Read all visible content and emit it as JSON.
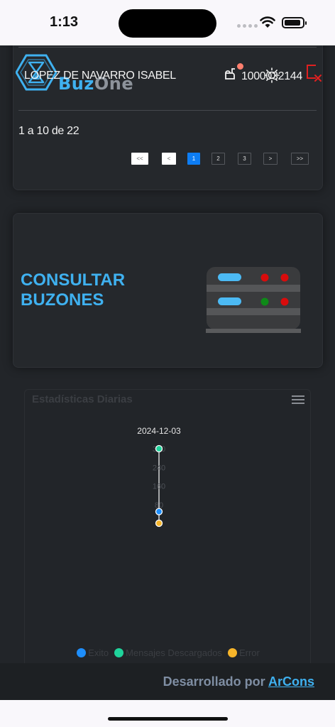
{
  "status": {
    "time": "1:13"
  },
  "header": {
    "logo_prefix": "Buz",
    "logo_suffix": "One",
    "user_name": "LOPEZ DE NAVARRO ISABEL",
    "user_id": "1000032144"
  },
  "pagination": {
    "info": "1 a 10 de 22",
    "first": "<<",
    "prev": "<",
    "pages": [
      "1",
      "2",
      "3"
    ],
    "next": ">",
    "last": ">>",
    "current_page": "1"
  },
  "consult": {
    "title": "CONSULTAR BUZONES"
  },
  "chart_data": {
    "type": "line",
    "title": "Estadísticas Diarias",
    "x": [
      "2024-12-03"
    ],
    "y_ticks": [
      0,
      80,
      160,
      240,
      320
    ],
    "ylim": [
      0,
      320
    ],
    "series": [
      {
        "name": "Exito",
        "color": "#1e8efb",
        "values": [
          50
        ]
      },
      {
        "name": "Mensajes Descargados",
        "color": "#1fd39b",
        "values": [
          320
        ]
      },
      {
        "name": "Error",
        "color": "#f7b52a",
        "values": [
          0
        ]
      }
    ],
    "legend_position": "bottom"
  },
  "footer": {
    "prefix": "Desarrollado por",
    "link": "ArCons"
  },
  "colors": {
    "accent": "#3fb1f0",
    "active_page": "#0d7df4",
    "background": "#222529"
  }
}
